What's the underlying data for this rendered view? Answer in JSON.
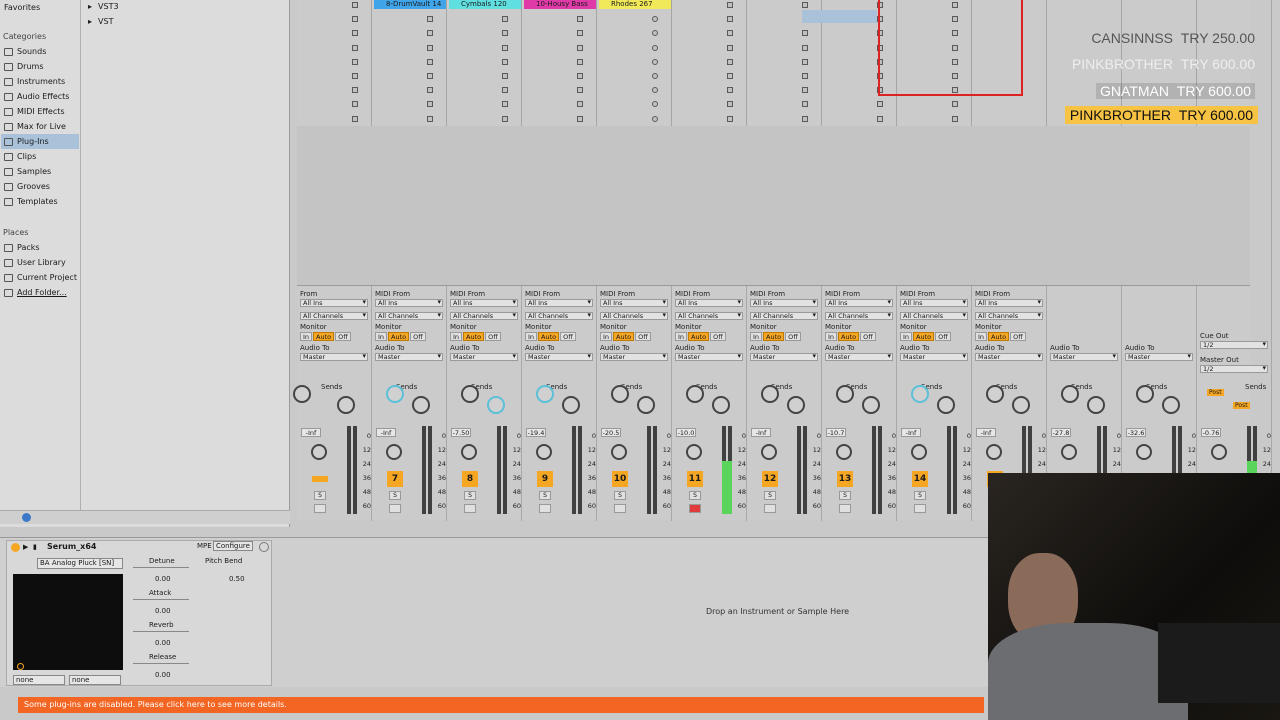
{
  "browser": {
    "favorites": "Favorites",
    "folders": [
      "VST3",
      "VST"
    ],
    "categories_header": "Categories",
    "categories": [
      "Sounds",
      "Drums",
      "Instruments",
      "Audio Effects",
      "MIDI Effects",
      "Max for Live",
      "Plug-Ins",
      "Clips",
      "Samples",
      "Grooves",
      "Templates"
    ],
    "selected": "Plug-Ins",
    "places_header": "Places",
    "places": [
      "Packs",
      "User Library",
      "Current Project",
      "Add Folder..."
    ]
  },
  "clips": [
    "8-DrumVault 14",
    "Cymbals 120",
    "10-Housy Bass",
    "Rhodes 267"
  ],
  "leaderboard": [
    {
      "name": "CANSINNSS",
      "amount": "TRY 250.00"
    },
    {
      "name": "PINKBROTHER",
      "amount": "TRY 600.00"
    },
    {
      "name": "GNATMAN",
      "amount": "TRY 600.00"
    },
    {
      "name": "PINKBROTHER",
      "amount": "TRY 600.00"
    }
  ],
  "mixer": {
    "midi_from": "MIDI From",
    "all_ins": "All Ins",
    "all_channels": "All Channels",
    "monitor": "Monitor",
    "mon_in": "In",
    "mon_auto": "Auto",
    "mon_off": "Off",
    "audio_to": "Audio To",
    "master": "Master",
    "sends": "Sends",
    "cue_out": "Cue Out",
    "master_out": "Master Out",
    "out_12": "1/2",
    "post": "Post",
    "from_partial": "From",
    "scale": [
      "0",
      "12",
      "24",
      "36",
      "48",
      "60"
    ],
    "strips": [
      {
        "num": "",
        "vol": "-Inf"
      },
      {
        "num": "7",
        "vol": "-Inf"
      },
      {
        "num": "8",
        "vol": "-7.50"
      },
      {
        "num": "9",
        "vol": "-19.4"
      },
      {
        "num": "10",
        "vol": "-20.5"
      },
      {
        "num": "11",
        "vol": "-10.0"
      },
      {
        "num": "12",
        "vol": "-Inf"
      },
      {
        "num": "13",
        "vol": "-10.7"
      },
      {
        "num": "14",
        "vol": "-Inf"
      },
      {
        "num": "15",
        "vol": "-Inf"
      },
      {
        "num": "",
        "vol": "-27.8"
      },
      {
        "num": "",
        "vol": "-32.6"
      },
      {
        "num": "",
        "vol": "-0.76"
      }
    ]
  },
  "device": {
    "name": "Serum_x64",
    "mpe": "MPE",
    "configure": "Configure",
    "preset": "BA Analog Pluck [SN]",
    "params": [
      {
        "label": "Detune",
        "value": "0.00"
      },
      {
        "label": "Attack",
        "value": "0.00"
      },
      {
        "label": "Reverb",
        "value": "0.00"
      },
      {
        "label": "Release",
        "value": "0.00"
      }
    ],
    "pitch_bend_label": "Pitch Bend",
    "pitch_bend_value": "0.50",
    "none1": "none",
    "none2": "none",
    "drop_hint": "Drop an Instrument or Sample Here"
  },
  "status_bar": "Some plug-ins are disabled. Please click here to see more details."
}
